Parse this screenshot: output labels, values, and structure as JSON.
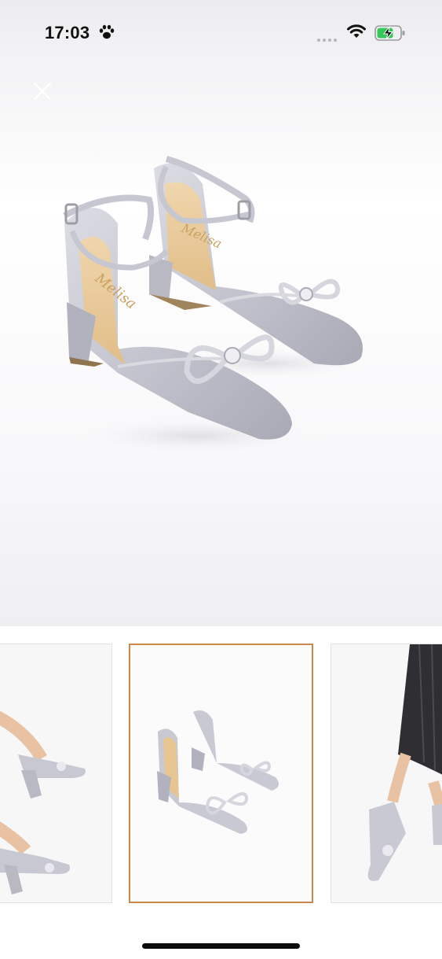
{
  "status_bar": {
    "time": "17:03",
    "paw_icon": "paw-icon",
    "wifi_icon": "wifi-icon",
    "battery_icon": "battery-charging-icon",
    "battery_color": "#34c759"
  },
  "viewer": {
    "close_icon": "close-icon",
    "hero_image": "silver-satin-bow-block-heels",
    "brand_on_insole": "Melisa"
  },
  "thumbnails": [
    {
      "name": "worn-heels-side-view",
      "selected": false
    },
    {
      "name": "silver-satin-bow-block-heels",
      "selected": true
    },
    {
      "name": "worn-heels-with-skirt",
      "selected": false
    }
  ],
  "colors": {
    "accent_border": "#c8894a",
    "satin": "#c9c9d3",
    "insole": "#e8c99a"
  }
}
